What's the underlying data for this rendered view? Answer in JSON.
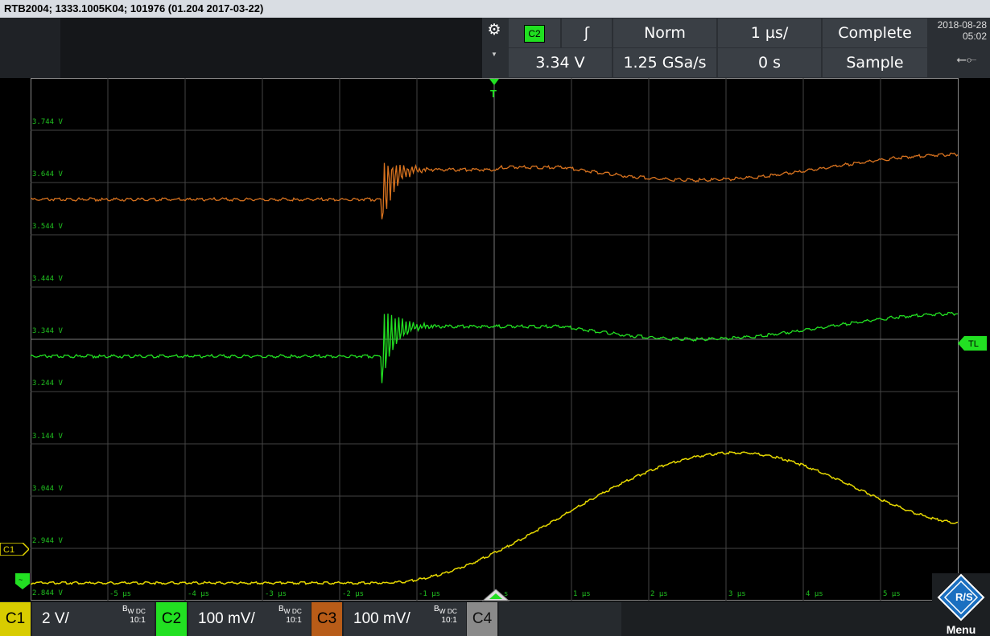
{
  "titlebar": {
    "text": "RTB2004; 1333.1005K04; 101976 (01.204 2017-03-22)"
  },
  "header": {
    "trigger_source": "C2",
    "slope_symbol": "ʃ",
    "trigger_mode": "Norm",
    "timebase": "1 µs/",
    "acq_state": "Complete",
    "trigger_level": "3.34 V",
    "sample_rate": "1.25 GSa/s",
    "time_offset": "0 s",
    "acq_mode": "Sample",
    "date": "2018-08-28",
    "time": "05:02",
    "gear_icon": "gear-icon",
    "usb_icon": "usb-icon"
  },
  "y_labels": [
    "3.744 V",
    "3.644 V",
    "3.544 V",
    "3.444 V",
    "3.344 V",
    "3.244 V",
    "3.144 V",
    "3.044 V",
    "2.944 V",
    "2.844 V"
  ],
  "x_labels": [
    "-5 µs",
    "-4 µs",
    "-3 µs",
    "-2 µs",
    "-1 µs",
    "s",
    "1 µs",
    "2 µs",
    "3 µs",
    "4 µs",
    "5 µs"
  ],
  "markers": {
    "c1": "C1",
    "tl": "TL",
    "trigger": "T"
  },
  "channels": [
    {
      "name": "C1",
      "scale": "2 V/",
      "bw": "B",
      "coupling": "W DC",
      "probe": "10:1",
      "color": "#e6d800"
    },
    {
      "name": "C2",
      "scale": "100 mV/",
      "bw": "B",
      "coupling": "W DC",
      "probe": "10:1",
      "color": "#22e022"
    },
    {
      "name": "C3",
      "scale": "100 mV/",
      "bw": "B",
      "coupling": "W DC",
      "probe": "10:1",
      "color": "#c8641a"
    },
    {
      "name": "C4",
      "scale": "",
      "color": "#999999"
    }
  ],
  "menu": {
    "label": "Menu"
  },
  "colors": {
    "c1": "#e6d800",
    "c2": "#22e022",
    "c3": "#d9731f",
    "grid": "#555555"
  }
}
